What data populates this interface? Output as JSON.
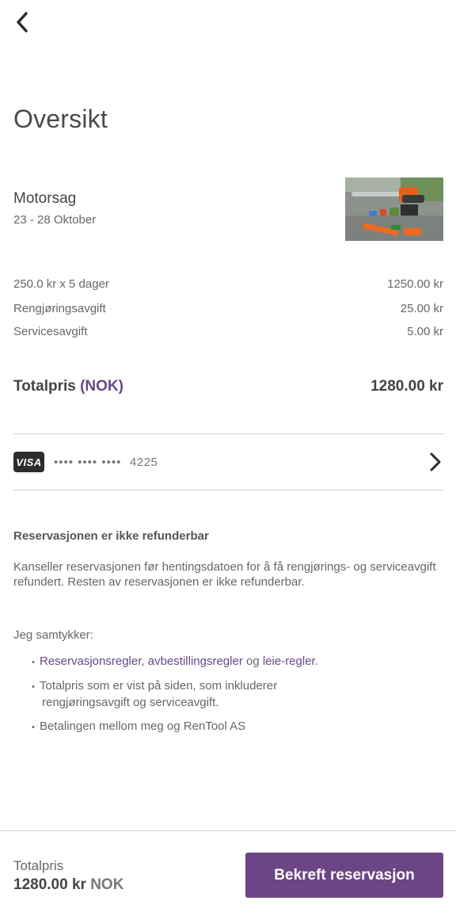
{
  "header": {
    "back_icon": "chevron-left-icon"
  },
  "page": {
    "title": "Oversikt"
  },
  "item": {
    "name": "Motorsag",
    "dates": "23 - 28 Oktober",
    "image_alt": "chainsaw-photo"
  },
  "pricing": {
    "rows": [
      {
        "label": "250.0 kr x 5 dager",
        "value": "1250.00 kr"
      },
      {
        "label": "Rengjøringsavgift",
        "value": "25.00 kr"
      },
      {
        "label": "Servicesavgift",
        "value": "5.00 kr"
      }
    ],
    "total_label": "Totalpris",
    "total_currency": "(NOK)",
    "total_value": "1280.00 kr"
  },
  "payment": {
    "brand": "VISA",
    "masked": "•••• •••• ••••",
    "last4": "4225"
  },
  "refund": {
    "title": "Reservasjonen er ikke refunderbar",
    "text": "Kanseller reservasjonen før hentingsdatoen for å få rengjørings- og serviceavgift refundert. Resten av reservasjonen er ikke refunderbar."
  },
  "consent": {
    "title": "Jeg samtykker:",
    "bullet": "•",
    "item1": {
      "link1": "Reservasjonsregler",
      "sep1": ", ",
      "link2": "avbestillingsregler",
      "sep2": " og ",
      "link3": "leie-regler",
      "end": "."
    },
    "item2_line1": "Totalpris som er vist på siden, som inkluderer",
    "item2_line2": "rengjøringsavgift og serviceavgift.",
    "item3": "Betalingen mellom meg og RenTool AS"
  },
  "footer": {
    "label": "Totalpris",
    "amount": "1280.00 kr",
    "currency": "NOK",
    "confirm_label": "Bekreft reservasjon"
  },
  "colors": {
    "accent": "#6b4585",
    "text": "#444444",
    "muted": "#666666"
  }
}
